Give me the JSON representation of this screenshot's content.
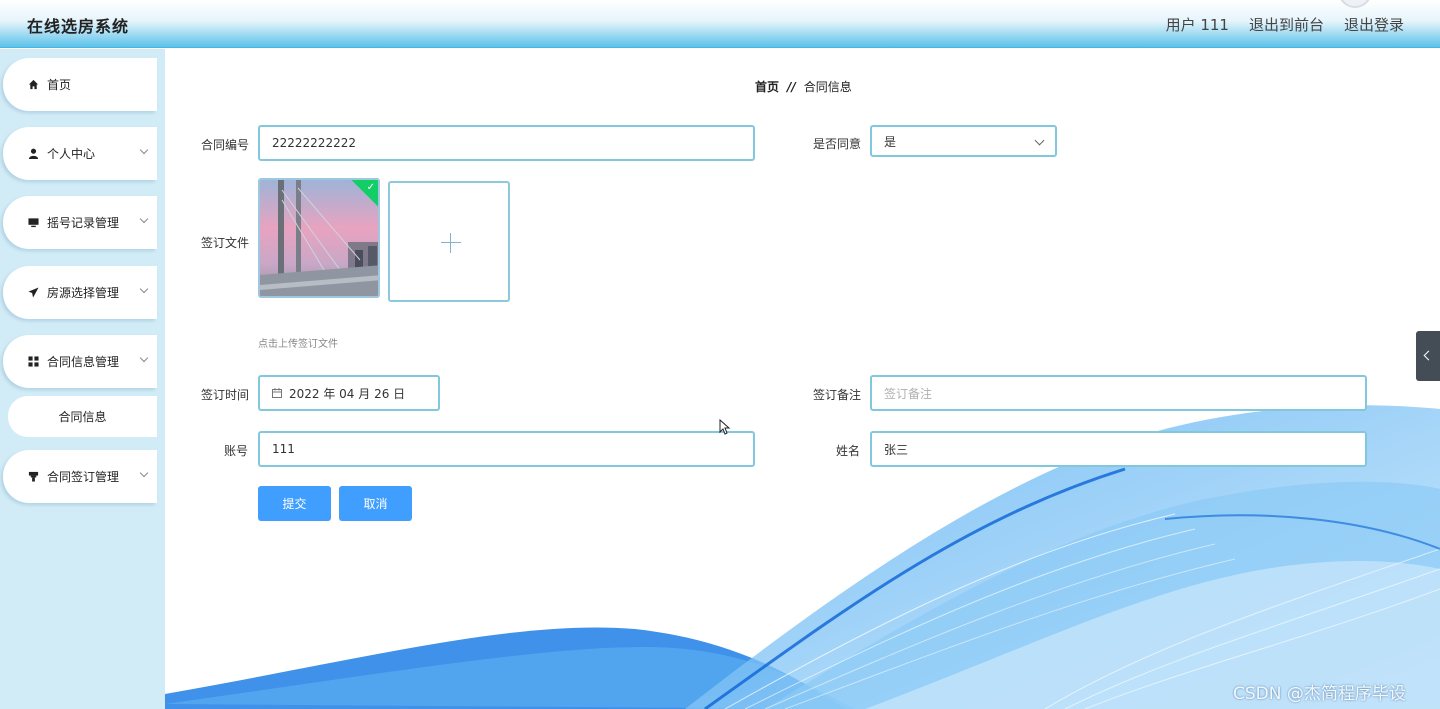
{
  "header": {
    "title": "在线选房系统",
    "user": "用户 111",
    "to_front": "退出到前台",
    "logout": "退出登录"
  },
  "sidebar": {
    "items": [
      {
        "label": "首页",
        "icon": "home-icon"
      },
      {
        "label": "个人中心",
        "icon": "person-icon"
      },
      {
        "label": "摇号记录管理",
        "icon": "monitor-icon"
      },
      {
        "label": "房源选择管理",
        "icon": "send-icon"
      },
      {
        "label": "合同信息管理",
        "icon": "grid-icon"
      },
      {
        "label": "合同签订管理",
        "icon": "stamp-icon"
      }
    ],
    "sub_item": "合同信息"
  },
  "breadcrumb": {
    "home": "首页",
    "sep": "//",
    "current": "合同信息"
  },
  "form": {
    "contract_no_label": "合同编号",
    "contract_no_value": "22222222222",
    "agree_label": "是否同意",
    "agree_value": "是",
    "file_label": "签订文件",
    "upload_hint": "点击上传签订文件",
    "sign_time_label": "签订时间",
    "sign_time_value": "2022 年 04 月 26 日",
    "remark_label": "签订备注",
    "remark_placeholder": "签订备注",
    "account_label": "账号",
    "account_value": "111",
    "name_label": "姓名",
    "name_value": "张三",
    "submit": "提交",
    "cancel": "取消"
  },
  "watermark": "CSDN @杰简程序毕设",
  "colors": {
    "accent": "#409eff",
    "input_border": "#82c8dc",
    "sidebar_bg": "#d2ecf7",
    "success": "#13ce66"
  }
}
